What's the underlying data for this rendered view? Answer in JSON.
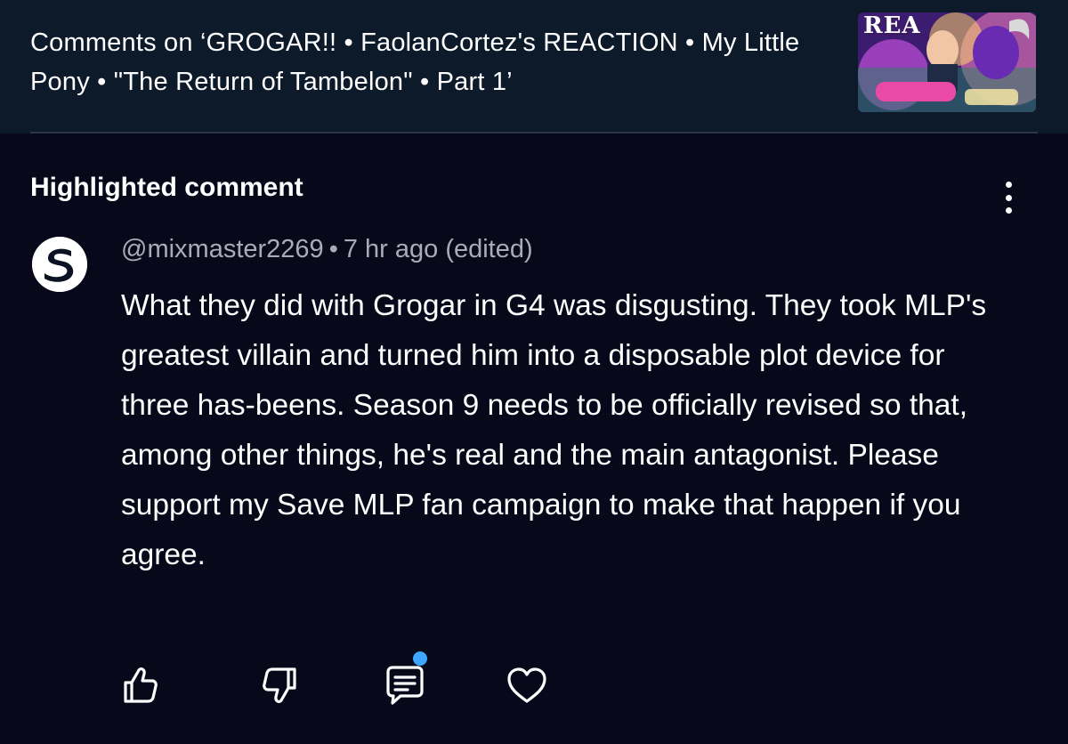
{
  "header": {
    "title": "Comments on ‘GROGAR!! • FaolanCortez's REACTION • My Little Pony • \"The Return of Tambelon\" • Part 1’",
    "thumbnail_text": "REA",
    "thumbnail_icon": "video-thumbnail"
  },
  "section": {
    "heading": "Highlighted comment",
    "menu_icon": "more-vertical-icon"
  },
  "comment": {
    "author": "@mixmaster2269",
    "separator": "•",
    "time": "7 hr ago (edited)",
    "body": "What they did with Grogar in G4 was disgusting. They took MLP's greatest villain and turned him into a disposable plot device for three has-beens. Season 9 needs to be officially revised so that, among other things, he's real and the main antagonist. Please support my Save MLP fan campaign to make that happen if you agree.",
    "avatar_icon": "channel-logo-s"
  },
  "actions": {
    "like_icon": "thumbs-up-icon",
    "dislike_icon": "thumbs-down-icon",
    "reply_icon": "comment-icon",
    "heart_icon": "heart-icon",
    "badge_color": "#3ea6ff"
  },
  "colors": {
    "background": "#07091b",
    "header_background": "#0c1a2a",
    "meta_text": "#a9acb8"
  }
}
